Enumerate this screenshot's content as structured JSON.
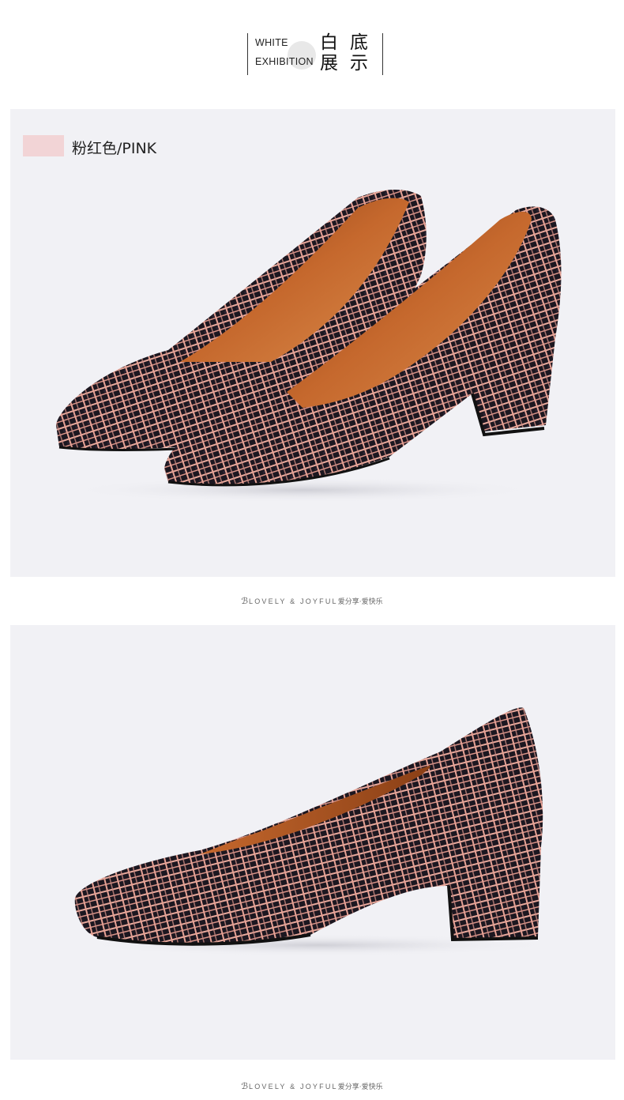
{
  "header": {
    "en_line1": "WHITE",
    "en_line2": "EXHIBITION",
    "cn_chars": [
      "白",
      "底",
      "展",
      "示"
    ]
  },
  "product": {
    "color_label": "粉红色/PINK",
    "swatch_color": "#f2d4d6"
  },
  "footer": {
    "mark": "ℬ",
    "text": "LOVELY & JOYFUL",
    "cn": "爱分享·爱快乐"
  },
  "images": [
    {
      "name": "pair-of-pumps-photo"
    },
    {
      "name": "single-pump-side-photo"
    }
  ]
}
